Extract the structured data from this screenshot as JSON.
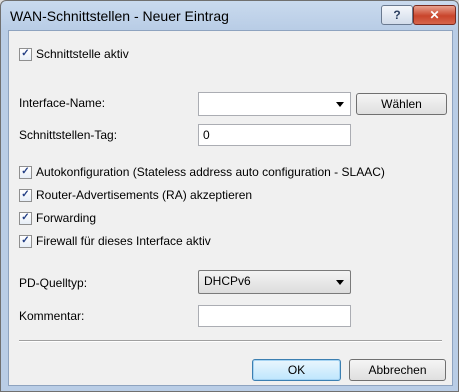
{
  "window": {
    "title": "WAN-Schnittstellen - Neuer Eintrag",
    "help_label": "?",
    "close_label": "✕"
  },
  "form": {
    "active": {
      "label": "Schnittstelle aktiv",
      "checked": true
    },
    "interface_name": {
      "label": "Interface-Name:",
      "value": "",
      "choose_button": "Wählen"
    },
    "tag": {
      "label": "Schnittstellen-Tag:",
      "value": "0"
    },
    "checks": [
      {
        "label": "Autokonfiguration (Stateless address auto configuration - SLAAC)",
        "checked": true
      },
      {
        "label": "Router-Advertisements (RA) akzeptieren",
        "checked": true
      },
      {
        "label": "Forwarding",
        "checked": true
      },
      {
        "label": "Firewall für dieses Interface aktiv",
        "checked": true
      }
    ],
    "pd_source": {
      "label": "PD-Quelltyp:",
      "value": "DHCPv6"
    },
    "comment": {
      "label": "Kommentar:",
      "value": ""
    }
  },
  "buttons": {
    "ok": "OK",
    "cancel": "Abbrechen"
  },
  "check_glyph": "✓"
}
